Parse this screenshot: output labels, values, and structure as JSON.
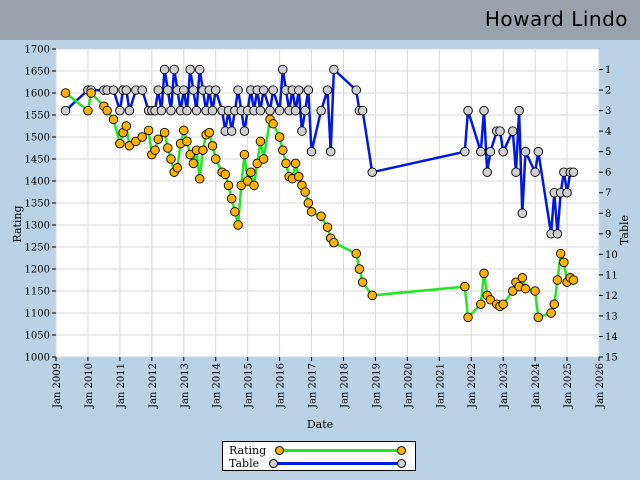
{
  "header": {
    "player_name": "Howard Lindo"
  },
  "legend": {
    "rating_label": "Rating",
    "table_label": "Table"
  },
  "chart_data": {
    "type": "line",
    "title": "",
    "xlabel": "Date",
    "ylabel": "Rating",
    "y2label": "Table",
    "xlim": [
      2009.0,
      2026.0
    ],
    "ylim": [
      1000,
      1700
    ],
    "y2lim": [
      15,
      0
    ],
    "grid": true,
    "legend_position": "bottom-center",
    "x_tick_labels": [
      "Jan 2009",
      "Jan 2010",
      "Jan 2011",
      "Jan 2012",
      "Jan 2013",
      "Jan 2014",
      "Jan 2015",
      "Jan 2016",
      "Jan 2017",
      "Jan 2018",
      "Jan 2019",
      "Jan 2020",
      "Jan 2021",
      "Jan 2022",
      "Jan 2023",
      "Jan 2024",
      "Jan 2025",
      "Jan 2026"
    ],
    "y_tick_labels": [
      "1000",
      "1050",
      "1100",
      "1150",
      "1200",
      "1250",
      "1300",
      "1350",
      "1400",
      "1450",
      "1500",
      "1550",
      "1600",
      "1650",
      "1700"
    ],
    "y2_tick_labels": [
      "1",
      "2",
      "3",
      "4",
      "5",
      "6",
      "7",
      "8",
      "9",
      "10",
      "11",
      "12",
      "13",
      "14",
      "15"
    ],
    "colors": {
      "rating_line": "#22e622",
      "rating_marker": "#ffb300",
      "table_line": "#0018e0",
      "table_marker": "#d0d0d0"
    },
    "series": [
      {
        "name": "Rating",
        "x": [
          2009.3,
          2010.0,
          2010.1,
          2010.5,
          2010.6,
          2010.8,
          2011.0,
          2011.1,
          2011.2,
          2011.3,
          2011.5,
          2011.7,
          2011.9,
          2012.0,
          2012.1,
          2012.2,
          2012.4,
          2012.5,
          2012.6,
          2012.7,
          2012.8,
          2012.9,
          2013.0,
          2013.1,
          2013.2,
          2013.3,
          2013.4,
          2013.5,
          2013.6,
          2013.7,
          2013.8,
          2013.9,
          2014.0,
          2014.2,
          2014.3,
          2014.4,
          2014.5,
          2014.6,
          2014.7,
          2014.8,
          2014.9,
          2015.0,
          2015.1,
          2015.2,
          2015.3,
          2015.4,
          2015.5,
          2015.7,
          2015.8,
          2016.0,
          2016.1,
          2016.2,
          2016.3,
          2016.4,
          2016.5,
          2016.6,
          2016.7,
          2016.8,
          2016.9,
          2017.0,
          2017.3,
          2017.5,
          2017.6,
          2017.7,
          2018.4,
          2018.5,
          2018.6,
          2018.9,
          2021.8,
          2021.9,
          2022.3,
          2022.4,
          2022.5,
          2022.6,
          2022.8,
          2022.9,
          2023.0,
          2023.3,
          2023.4,
          2023.5,
          2023.6,
          2023.7,
          2024.0,
          2024.1,
          2024.5,
          2024.6,
          2024.7,
          2024.8,
          2024.9,
          2025.0,
          2025.1,
          2025.2
        ],
        "values": [
          1600,
          1560,
          1600,
          1570,
          1560,
          1540,
          1485,
          1510,
          1525,
          1480,
          1490,
          1500,
          1515,
          1460,
          1470,
          1495,
          1510,
          1475,
          1450,
          1420,
          1430,
          1485,
          1515,
          1490,
          1460,
          1440,
          1470,
          1405,
          1470,
          1505,
          1510,
          1480,
          1450,
          1420,
          1415,
          1390,
          1360,
          1330,
          1300,
          1390,
          1460,
          1400,
          1420,
          1390,
          1440,
          1490,
          1450,
          1540,
          1530,
          1500,
          1470,
          1440,
          1410,
          1405,
          1440,
          1410,
          1390,
          1375,
          1350,
          1330,
          1320,
          1295,
          1270,
          1260,
          1235,
          1200,
          1170,
          1140,
          1160,
          1090,
          1120,
          1190,
          1140,
          1130,
          1120,
          1115,
          1120,
          1150,
          1170,
          1160,
          1180,
          1155,
          1150,
          1090,
          1100,
          1120,
          1175,
          1235,
          1215,
          1170,
          1180,
          1175
        ]
      },
      {
        "name": "Table",
        "x": [
          2009.3,
          2010.0,
          2010.1,
          2010.5,
          2010.6,
          2010.8,
          2011.0,
          2011.1,
          2011.2,
          2011.3,
          2011.5,
          2011.7,
          2011.9,
          2012.0,
          2012.1,
          2012.2,
          2012.3,
          2012.4,
          2012.5,
          2012.6,
          2012.7,
          2012.8,
          2012.9,
          2013.0,
          2013.1,
          2013.2,
          2013.3,
          2013.4,
          2013.5,
          2013.6,
          2013.7,
          2013.8,
          2013.9,
          2014.0,
          2014.2,
          2014.3,
          2014.4,
          2014.5,
          2014.6,
          2014.7,
          2014.8,
          2014.9,
          2015.0,
          2015.1,
          2015.2,
          2015.3,
          2015.4,
          2015.5,
          2015.7,
          2015.8,
          2016.0,
          2016.1,
          2016.2,
          2016.3,
          2016.4,
          2016.5,
          2016.6,
          2016.7,
          2016.8,
          2016.9,
          2017.0,
          2017.3,
          2017.5,
          2017.6,
          2017.7,
          2018.4,
          2018.5,
          2018.6,
          2018.9,
          2021.8,
          2021.9,
          2022.3,
          2022.4,
          2022.5,
          2022.6,
          2022.8,
          2022.9,
          2023.0,
          2023.3,
          2023.4,
          2023.5,
          2023.6,
          2023.7,
          2024.0,
          2024.1,
          2024.5,
          2024.6,
          2024.7,
          2024.8,
          2024.9,
          2025.0,
          2025.1,
          2025.2
        ],
        "values": [
          3,
          2,
          2,
          2,
          2,
          2,
          3,
          2,
          2,
          3,
          2,
          2,
          3,
          3,
          3,
          2,
          3,
          1,
          2,
          3,
          1,
          2,
          3,
          2,
          3,
          1,
          2,
          3,
          1,
          2,
          3,
          2,
          3,
          2,
          3,
          4,
          3,
          4,
          3,
          2,
          3,
          4,
          3,
          2,
          3,
          2,
          3,
          2,
          3,
          2,
          3,
          1,
          2,
          3,
          2,
          3,
          2,
          4,
          3,
          2,
          5,
          3,
          2,
          5,
          1,
          2,
          3,
          3,
          6,
          5,
          3,
          5,
          3,
          6,
          5,
          4,
          4,
          5,
          4,
          6,
          3,
          8,
          5,
          6,
          5,
          9,
          7,
          9,
          7,
          6,
          7,
          6,
          6
        ]
      }
    ]
  }
}
